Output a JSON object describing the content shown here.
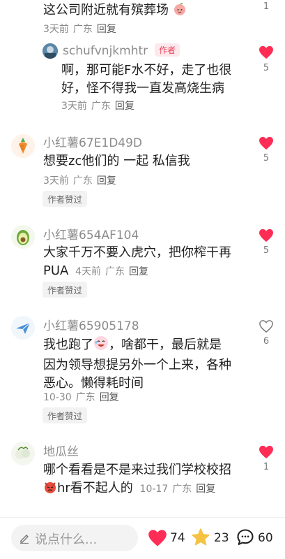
{
  "comments": [
    {
      "text": "这公司附近就有殡葬场",
      "time": "3天前",
      "location": "广东",
      "reply": "回复",
      "likes": "1"
    },
    {
      "username": "schufvnjkmhtr",
      "author_tag": "作者",
      "text_lines": [
        "啊，那可能F水不好，走了也很",
        "好，怪不得我一直发高烧生病"
      ],
      "time": "3天前",
      "location": "广东",
      "reply": "回复",
      "likes": "5"
    },
    {
      "username": "小红薯67E1D49D",
      "text": "想要zc他们的 一起 私信我",
      "time": "3天前",
      "location": "广东",
      "reply": "回复",
      "liked_by_author": "作者赞过",
      "likes": "5"
    },
    {
      "username": "小红薯654AF104",
      "text_lines": [
        "大家千万不要入虎穴，把你榨干再",
        "PUA"
      ],
      "time": "4天前",
      "location": "广东",
      "reply": "回复",
      "liked_by_author": "作者赞过",
      "likes": "5"
    },
    {
      "username": "小红薯65905178",
      "text_lines": [
        "我也跑了",
        "，啥都干，最后就是",
        "因为领导想提另外一个上来，各种",
        "恶心。懒得耗时间"
      ],
      "time": "10-30",
      "location": "广东",
      "reply": "回复",
      "liked_by_author": "作者赞过",
      "likes": "6"
    },
    {
      "username": "地瓜丝",
      "text_lines": [
        "哪个看看是不是来过我们学校校招",
        "hr看不起人的"
      ],
      "time": "10-17",
      "location": "广东",
      "reply": "回复",
      "likes": "1"
    }
  ],
  "bottom_bar": {
    "placeholder": "说点什么...",
    "likes": "74",
    "favorites": "23",
    "comments": "60"
  },
  "colors": {
    "heart_red": "#ff2d55",
    "star_yellow": "#f5c242",
    "author_tag_red": "#e8415a"
  },
  "icons": {
    "like": "heart-icon",
    "favorite": "star-icon",
    "comment": "comment-bubble-icon",
    "edit": "pencil-icon"
  }
}
